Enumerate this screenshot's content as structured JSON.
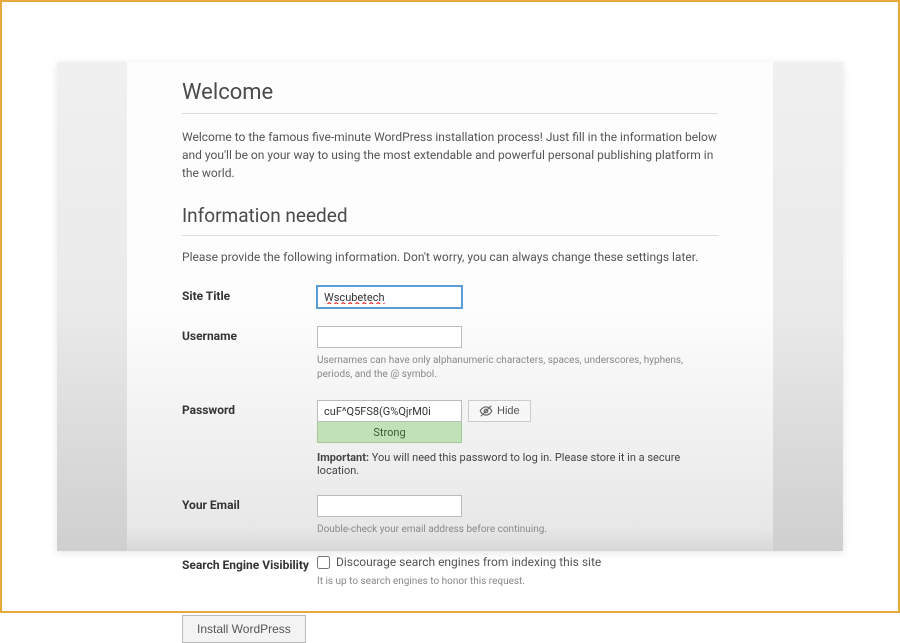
{
  "headings": {
    "welcome": "Welcome",
    "info_needed": "Information needed"
  },
  "intro_text": "Welcome to the famous five-minute WordPress installation process! Just fill in the information below and you'll be on your way to using the most extendable and powerful personal publishing platform in the world.",
  "subinfo_text": "Please provide the following information. Don't worry, you can always change these settings later.",
  "form": {
    "site_title": {
      "label": "Site Title",
      "value": "Wscubetech"
    },
    "username": {
      "label": "Username",
      "value": "",
      "help": "Usernames can have only alphanumeric characters, spaces, underscores, hyphens, periods, and the @ symbol."
    },
    "password": {
      "label": "Password",
      "value": "cuF^Q5FS8(G%QjrM0i",
      "hide_label": "Hide",
      "strength": "Strong",
      "important_label": "Important:",
      "important_text": " You will need this password to log in. Please store it in a secure location."
    },
    "email": {
      "label": "Your Email",
      "value": "",
      "help": "Double-check your email address before continuing."
    },
    "search_visibility": {
      "label": "Search Engine Visibility",
      "checkbox_label": "Discourage search engines from indexing this site",
      "help": "It is up to search engines to honor this request."
    }
  },
  "install_button": "Install WordPress"
}
